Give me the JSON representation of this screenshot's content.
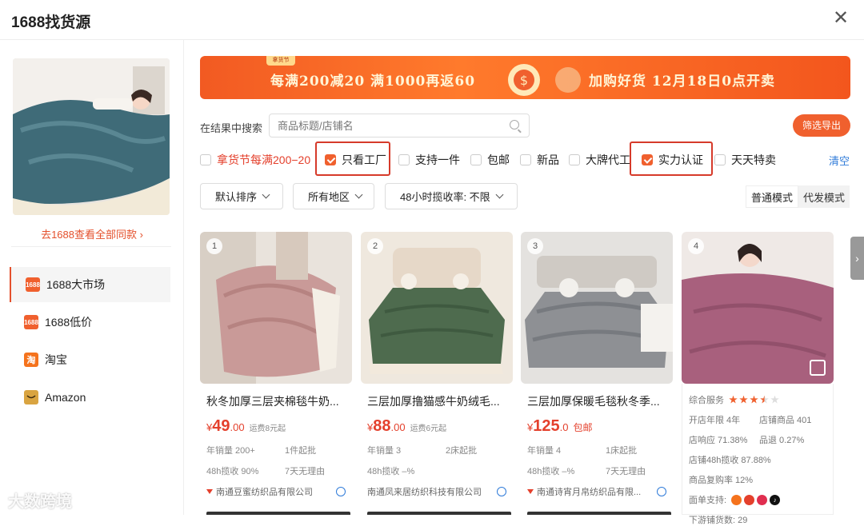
{
  "header": {
    "title": "1688找货源"
  },
  "left": {
    "see_all": "去1688查看全部同款 ›",
    "nav": [
      {
        "label": "1688大市场",
        "icon": "1688-icon",
        "color": "#f0602e",
        "active": true
      },
      {
        "label": "1688低价",
        "icon": "1688-icon",
        "color": "#f0602e"
      },
      {
        "label": "淘宝",
        "icon": "taobao-icon",
        "color": "#f5731d"
      },
      {
        "label": "Amazon",
        "icon": "amazon-icon",
        "color": "#d9a441"
      }
    ]
  },
  "banner": {
    "tag": "拿货节",
    "promo1": "每满200减20 满1000再返60",
    "promo2": "加购好货 12月18日0点开卖"
  },
  "search": {
    "label": "在结果中搜索",
    "placeholder": "商品标题/店铺名"
  },
  "export_label": "筛选导出",
  "filters": [
    {
      "label": "拿货节每满200−20",
      "checked": false,
      "accent": true
    },
    {
      "label": "只看工厂",
      "checked": true,
      "highlighted": true
    },
    {
      "label": "支持一件",
      "checked": false
    },
    {
      "label": "包邮",
      "checked": false
    },
    {
      "label": "新品",
      "checked": false
    },
    {
      "label": "大牌代工",
      "checked": false
    },
    {
      "label": "实力认证",
      "checked": true,
      "highlighted": true
    },
    {
      "label": "天天特卖",
      "checked": false
    }
  ],
  "clear_label": "清空",
  "dropdowns": [
    "默认排序",
    "所有地区",
    "48小时揽收率: 不限"
  ],
  "modes": [
    "普通模式",
    "代发模式"
  ],
  "products": [
    {
      "rank": "1",
      "name": "秋冬加厚三层夹棉毯牛奶...",
      "currency": "¥",
      "price_int": "49",
      "price_dec": ".00",
      "shipping": "运费8元起",
      "sales": "年销量 200+",
      "moq": "1件起批",
      "pickup": "48h揽收 90%",
      "returns": "7天无理由",
      "shop": "南通豆蜜纺织品有限公司"
    },
    {
      "rank": "2",
      "name": "三层加厚撸猫感牛奶绒毛...",
      "currency": "¥",
      "price_int": "88",
      "price_dec": ".00",
      "shipping": "运费6元起",
      "sales": "年销量 3",
      "moq": "2床起批",
      "pickup": "48h揽收 –%",
      "returns": "",
      "shop": "南通凤来居纺织科技有限公司"
    },
    {
      "rank": "3",
      "name": "三层加厚保暖毛毯秋冬季...",
      "currency": "¥",
      "price_int": "125",
      "price_dec": ".0",
      "shipping": "包邮",
      "sales": "年销量 4",
      "moq": "1床起批",
      "pickup": "48h揽收 –%",
      "returns": "7天无理由",
      "shop": "南通诗宵月帛纺织品有限..."
    },
    {
      "rank": "4"
    }
  ],
  "shop_info": {
    "service_label": "综合服务",
    "rows": [
      [
        "开店年限 4年",
        "店铺商品 401"
      ],
      [
        "店响应 71.38%",
        "品退 0.27%"
      ],
      [
        "店铺48h揽收 87.88%",
        ""
      ],
      [
        "商品复购率 12%",
        ""
      ]
    ],
    "support_label": "面单支持:",
    "downstream": "下游铺货数: 29"
  },
  "watermark": "大数跨境",
  "colors": {
    "accent": "#f0602e",
    "link": "#2f7bd9",
    "highlight": "#d63a2a"
  }
}
